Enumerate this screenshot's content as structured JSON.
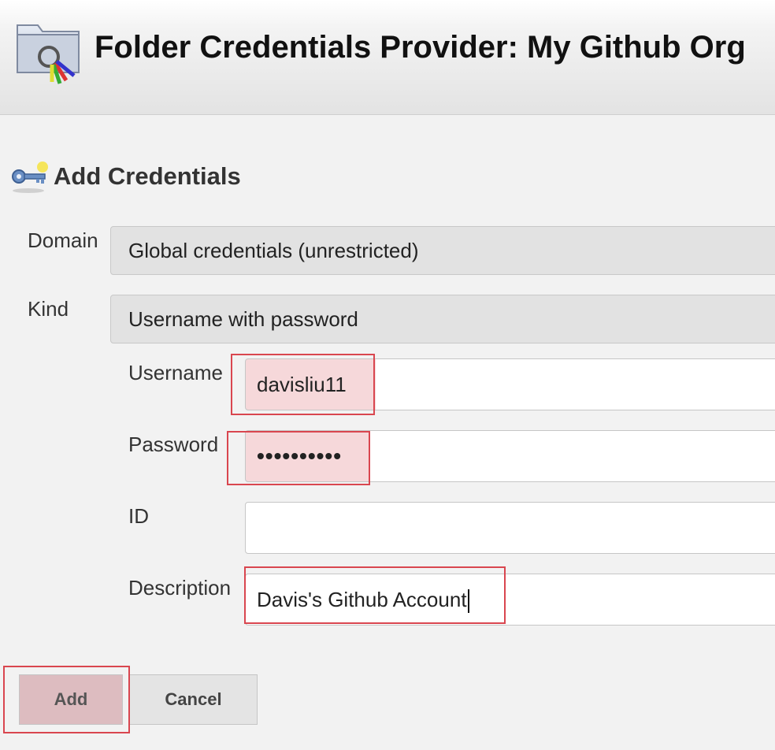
{
  "header": {
    "title": "Folder Credentials Provider: My Github Org",
    "icon": "folder-keys-icon"
  },
  "section": {
    "title": "Add Credentials",
    "icon": "key-icon"
  },
  "form": {
    "domain": {
      "label": "Domain",
      "value": "Global credentials (unrestricted)"
    },
    "kind": {
      "label": "Kind",
      "value": "Username with password"
    },
    "username": {
      "label": "Username",
      "value": "davisliu11"
    },
    "password": {
      "label": "Password",
      "value": "••••••••••"
    },
    "id": {
      "label": "ID",
      "value": ""
    },
    "description": {
      "label": "Description",
      "value": "Davis's Github Account"
    }
  },
  "buttons": {
    "add": "Add",
    "cancel": "Cancel"
  },
  "colors": {
    "highlight": "#d9464f",
    "background": "#f2f2f2"
  }
}
